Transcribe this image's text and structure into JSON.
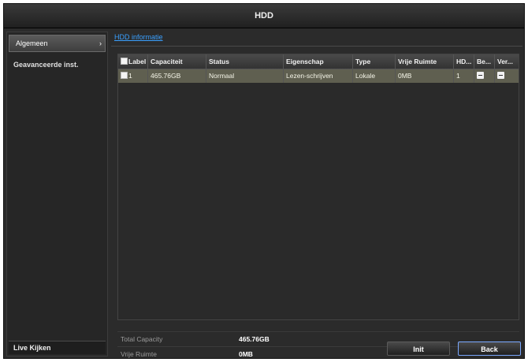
{
  "window": {
    "title": "HDD"
  },
  "sidebar": {
    "items": [
      {
        "label": "Algemeen",
        "active": true
      },
      {
        "label": "Geavanceerde inst."
      }
    ],
    "bottom_label": "Live Kijken"
  },
  "tabs": [
    {
      "label": "HDD informatie"
    }
  ],
  "table": {
    "headers": {
      "label": "Label",
      "capacity": "Capaciteit",
      "status": "Status",
      "property": "Eigenschap",
      "type": "Type",
      "free": "Vrije Ruimte",
      "hdd": "HD...",
      "be": "Be...",
      "ver": "Ver..."
    },
    "rows": [
      {
        "label": "1",
        "capacity": "465.76GB",
        "status": "Normaal",
        "property": "Lezen-schrijven",
        "type": "Lokale",
        "free": "0MB",
        "hdd": "1"
      }
    ]
  },
  "summary": {
    "total_capacity_label": "Total Capacity",
    "total_capacity_value": "465.76GB",
    "free_label": "Vrije Ruimte",
    "free_value": "0MB"
  },
  "buttons": {
    "init": "Init",
    "back": "Back"
  }
}
